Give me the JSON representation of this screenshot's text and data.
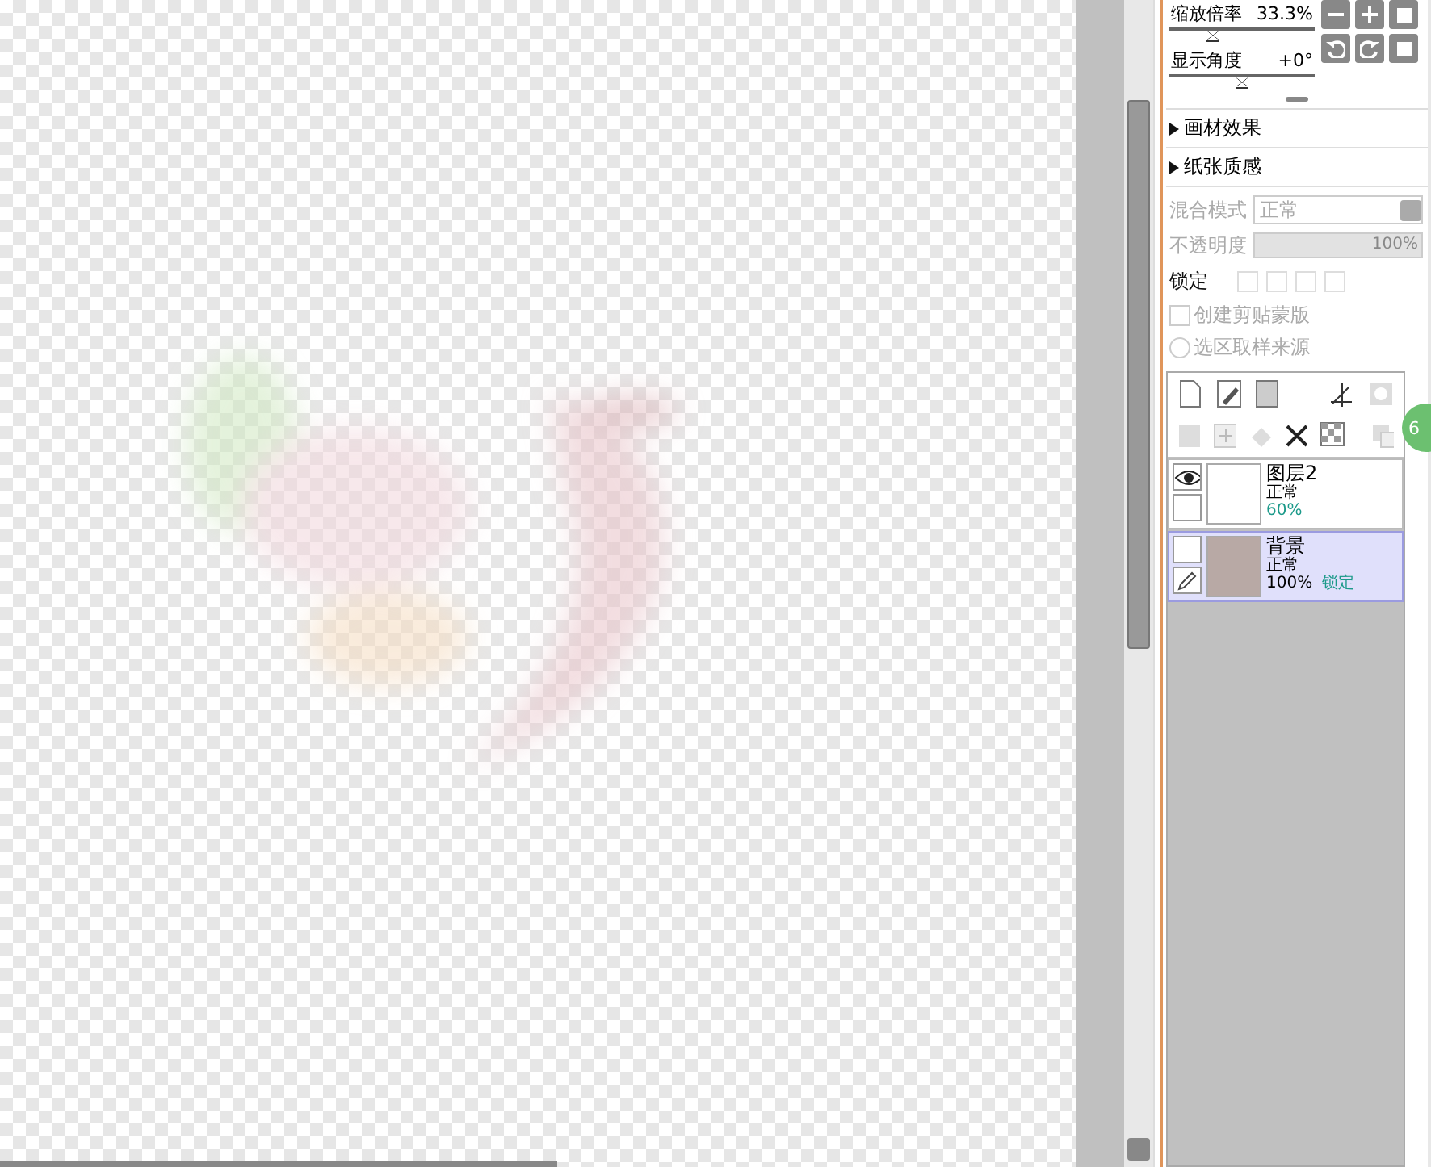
{
  "navigator": {
    "rows": [
      {
        "label": "缩放倍率",
        "value": "33.3%",
        "level": 0.3
      },
      {
        "label": "显示角度",
        "value": "+0°",
        "level": 0.5
      }
    ]
  },
  "sections": [
    {
      "label": "画材效果",
      "expanded": false
    },
    {
      "label": "纸张质感",
      "expanded": false
    }
  ],
  "layer_props": {
    "disabled": true,
    "blend_label": "混合模式",
    "blend_value": "正常",
    "opacity_label": "不透明度",
    "opacity_value": "100%",
    "level": 1,
    "lock_label": "锁定",
    "options": [
      {
        "kind": "checkbox",
        "label": "创建剪贴蒙版",
        "checked": false
      },
      {
        "kind": "radio",
        "label": "选区取样来源",
        "checked": false
      }
    ]
  },
  "layers": [
    {
      "name": "图层2",
      "mode": "正常",
      "opacity": "60%",
      "visible": true,
      "selected": false,
      "kind": "blank"
    },
    {
      "name": "背景",
      "mode": "正常",
      "opacity": "100%",
      "lock": "锁定",
      "visible": false,
      "selected": true,
      "kind": "photo"
    }
  ],
  "floating_badge": "6"
}
